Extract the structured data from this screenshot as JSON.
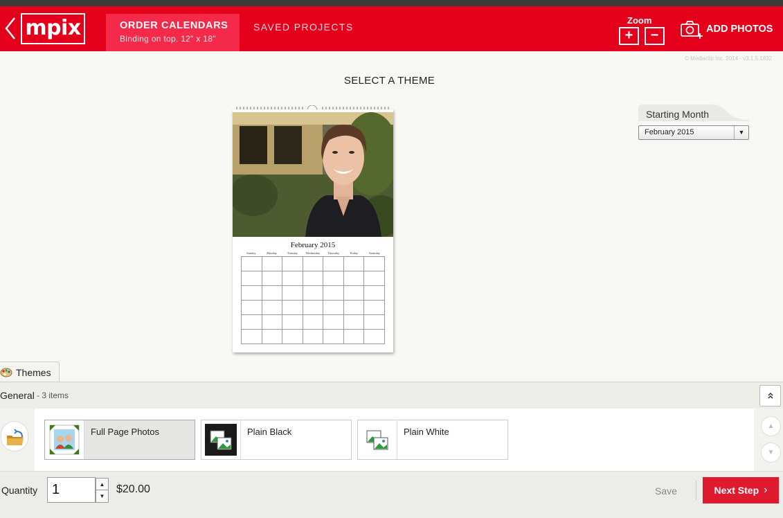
{
  "header": {
    "logo": "mpix",
    "order_title": "ORDER CALENDARS",
    "order_subtitle": "Binding on top, 12\" x 18\"",
    "saved_projects": "SAVED PROJECTS",
    "zoom_label": "Zoom",
    "zoom_in": "+",
    "zoom_out": "−",
    "add_photos": "ADD PHOTOS"
  },
  "copyright": "© Mediaclip Inc. 2014 - v3.1.5.1832",
  "main": {
    "heading": "SELECT A THEME",
    "starting_month_label": "Starting Month",
    "starting_month_value": "February 2015",
    "calendar": {
      "month_title": "February 2015",
      "weekdays": [
        "Sunday",
        "Monday",
        "Tuesday",
        "Wednesday",
        "Thursday",
        "Friday",
        "Saturday"
      ]
    }
  },
  "themes_panel": {
    "tab_label": "Themes",
    "category": "General",
    "count": "- 3 items",
    "themes": [
      {
        "name": "Full Page Photos",
        "selected": true
      },
      {
        "name": "Plain Black",
        "selected": false
      },
      {
        "name": "Plain White",
        "selected": false
      }
    ]
  },
  "footer": {
    "quantity_label": "Quantity",
    "quantity_value": "1",
    "price": "$20.00",
    "save": "Save",
    "next_step": "Next Step"
  },
  "colors": {
    "brand_red": "#e4001b",
    "active_tab": "#f52a4a",
    "next_button": "#e01a2e"
  }
}
